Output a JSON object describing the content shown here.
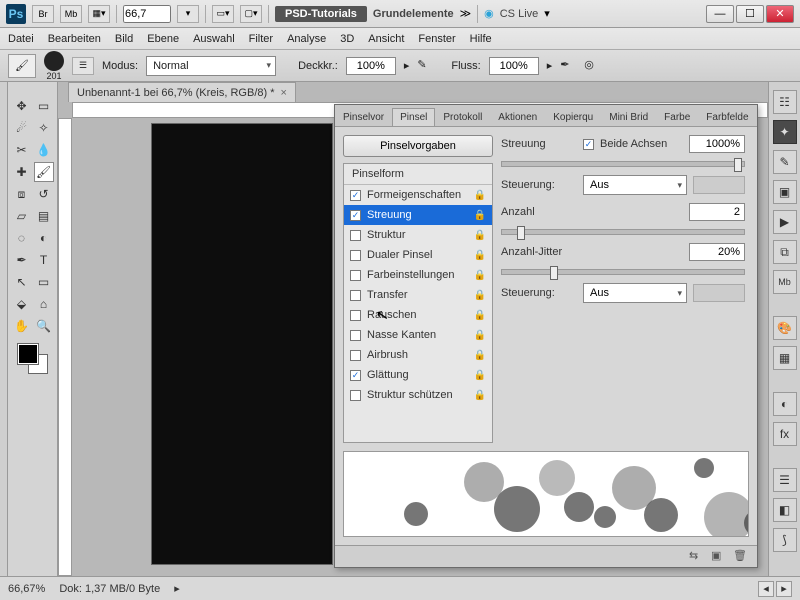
{
  "titlebar": {
    "logo": "Ps",
    "btns": [
      "Br",
      "Mb"
    ],
    "zoom": "66,7",
    "pill": "PSD-Tutorials",
    "workspace": "Grundelemente",
    "cslive": "CS Live"
  },
  "menu": [
    "Datei",
    "Bearbeiten",
    "Bild",
    "Ebene",
    "Auswahl",
    "Filter",
    "Analyse",
    "3D",
    "Ansicht",
    "Fenster",
    "Hilfe"
  ],
  "optbar": {
    "brush_size": "201",
    "mode_label": "Modus:",
    "mode_value": "Normal",
    "opacity_label": "Deckkr.:",
    "opacity_value": "100%",
    "flow_label": "Fluss:",
    "flow_value": "100%"
  },
  "doc": {
    "tab": "Unbenannt-1 bei 66,7% (Kreis, RGB/8) *"
  },
  "panel": {
    "tabs": [
      "Pinselvor",
      "Pinsel",
      "Protokoll",
      "Aktionen",
      "Kopierqu",
      "Mini Brid",
      "Farbe",
      "Farbfelde"
    ],
    "active_tab": 1,
    "presets_btn": "Pinselvorgaben",
    "list_header": "Pinselform",
    "items": [
      {
        "label": "Formeigenschaften",
        "checked": true,
        "lock": true
      },
      {
        "label": "Streuung",
        "checked": true,
        "lock": true,
        "selected": true
      },
      {
        "label": "Struktur",
        "checked": false,
        "lock": true
      },
      {
        "label": "Dualer Pinsel",
        "checked": false,
        "lock": true
      },
      {
        "label": "Farbeinstellungen",
        "checked": false,
        "lock": true
      },
      {
        "label": "Transfer",
        "checked": false,
        "lock": true
      },
      {
        "label": "Rauschen",
        "checked": false,
        "lock": true
      },
      {
        "label": "Nasse Kanten",
        "checked": false,
        "lock": true
      },
      {
        "label": "Airbrush",
        "checked": false,
        "lock": true
      },
      {
        "label": "Glättung",
        "checked": true,
        "lock": true
      },
      {
        "label": "Struktur schützen",
        "checked": false,
        "lock": true
      }
    ],
    "scatter": {
      "label": "Streuung",
      "both_axes_label": "Beide Achsen",
      "both_axes_checked": true,
      "value": "1000%",
      "control_label": "Steuerung:",
      "control_value": "Aus",
      "count_label": "Anzahl",
      "count_value": "2",
      "count_jitter_label": "Anzahl-Jitter",
      "count_jitter_value": "20%",
      "control2_label": "Steuerung:",
      "control2_value": "Aus"
    }
  },
  "status": {
    "zoom": "66,67%",
    "doc_info": "Dok: 1,37 MB/0 Byte"
  }
}
